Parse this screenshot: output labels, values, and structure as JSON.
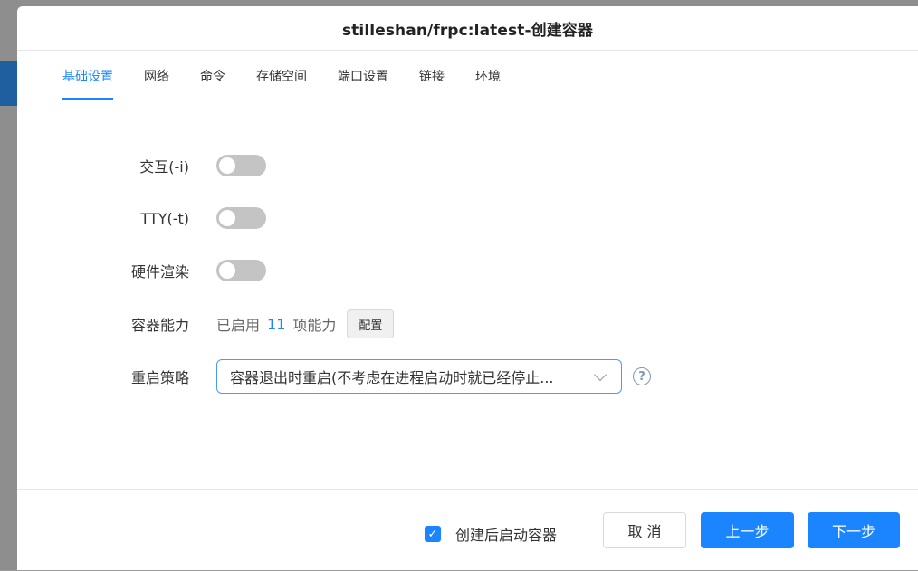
{
  "dialog": {
    "title": "stilleshan/frpc:latest-创建容器"
  },
  "tabs": [
    {
      "label": "基础设置",
      "active": true
    },
    {
      "label": "网络",
      "active": false
    },
    {
      "label": "命令",
      "active": false
    },
    {
      "label": "存储空间",
      "active": false
    },
    {
      "label": "端口设置",
      "active": false
    },
    {
      "label": "链接",
      "active": false
    },
    {
      "label": "环境",
      "active": false
    }
  ],
  "form": {
    "interactive": {
      "label": "交互(-i)",
      "enabled": false
    },
    "tty": {
      "label": "TTY(-t)",
      "enabled": false
    },
    "hw_render": {
      "label": "硬件渲染",
      "enabled": false
    },
    "capabilities": {
      "label": "容器能力",
      "prefix": "已启用",
      "count": "11",
      "suffix": "项能力",
      "config_label": "配置"
    },
    "restart_policy": {
      "label": "重启策略",
      "value": "容器退出时重启(不考虑在进程启动时就已经停止..."
    }
  },
  "footer": {
    "start_after_create_label": "创建后启动容器",
    "start_after_create_checked": true,
    "cancel_label": "取 消",
    "prev_label": "上一步",
    "next_label": "下一步"
  },
  "colors": {
    "accent": "#1a85ff",
    "toggle_off": "#c4c4c4"
  }
}
